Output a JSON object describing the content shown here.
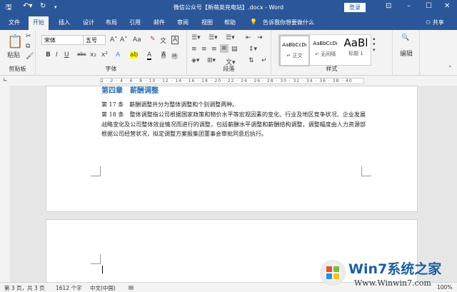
{
  "window": {
    "title": "微信公众号【新萌英充电站】.docx - Word",
    "login": "登录"
  },
  "tabs": [
    {
      "label": "文件"
    },
    {
      "label": "开始",
      "active": true
    },
    {
      "label": "插入"
    },
    {
      "label": "设计"
    },
    {
      "label": "布局"
    },
    {
      "label": "引用"
    },
    {
      "label": "邮件"
    },
    {
      "label": "审阅"
    },
    {
      "label": "视图"
    },
    {
      "label": "帮助"
    }
  ],
  "tell_me": "告诉我你想要做什么",
  "share": "共享",
  "ribbon": {
    "clipboard": {
      "paste": "粘贴",
      "label": "剪贴板"
    },
    "font": {
      "name": "宋体",
      "size": "五号",
      "label": "字体",
      "bold": "B",
      "italic": "I",
      "underline": "U",
      "strike": "abc",
      "sub": "x₂",
      "sup": "x²",
      "case": "Aa"
    },
    "paragraph": {
      "label": "段落"
    },
    "styles": {
      "label": "样式",
      "items": [
        {
          "preview": "AaBbCcDı",
          "name": "↵ 正文"
        },
        {
          "preview": "AaBbCcDı",
          "name": "↵ 无间隔"
        },
        {
          "preview": "AaBl",
          "name": "标题 1"
        }
      ]
    },
    "editing": {
      "label": "编辑"
    }
  },
  "ruler_ticks": "2 · 2 · 4 · 6 · 8 · 10 · 12 · 14 · 16 · 18 · 20 · 22 · 24 · 26 · 28 · 30 · 32 · 34 · 36 · 38 · 40",
  "document": {
    "heading": "第四章　薪酬调整",
    "paragraphs": [
      "第 17 条　薪酬调整共分为整体调整和个别调整两种。",
      "第 18 条　整体调整指公司根据国家政策和物价水平等宏观因素的变化、行业及地区竞争状况、企业发展战略变化及公司整体效益情况而进行的调整，包括薪酬水平调整和薪酬结构调整，调整幅度由人力资源部根据公司经营状况，拟定调整方案报集团董事会审批同意后执行。"
    ]
  },
  "status": {
    "page": "第 3 页，共 3 页",
    "words": "1612 个字",
    "lang": "中文(中国)",
    "zoom": "100%"
  },
  "watermark": {
    "brand": "Win7系统之家",
    "url": "Www.Winwin7.com"
  },
  "colors": {
    "accent": "#2b579a",
    "heading": "#2e74b5"
  }
}
